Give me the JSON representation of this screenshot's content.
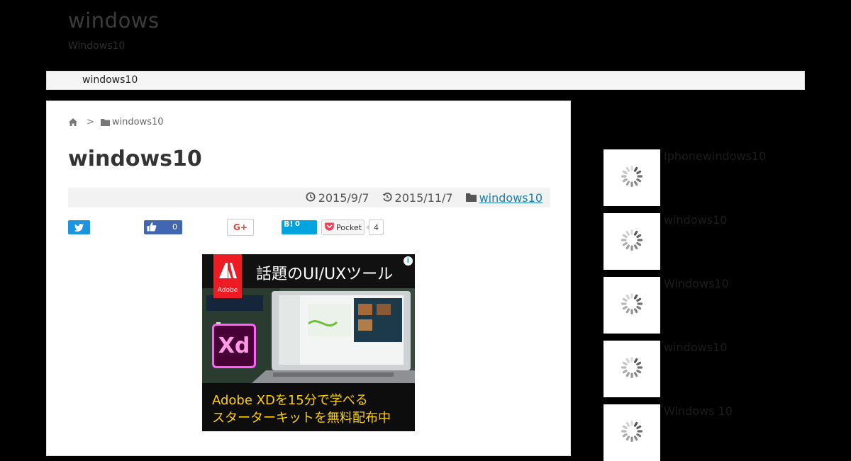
{
  "site": {
    "title": "windows",
    "description": "Windows10"
  },
  "nav": {
    "items": [
      {
        "label": "windows10"
      }
    ]
  },
  "breadcrumb": {
    "separator": ">",
    "category": "windows10"
  },
  "post": {
    "title": "windows10",
    "published": "2015/9/7",
    "updated": "2015/11/7",
    "category": "windows10"
  },
  "share": {
    "facebook_count": "0",
    "google_plus_label": "G+",
    "hatena_label": "B!",
    "hatena_count": "0",
    "pocket_label": "Pocket",
    "pocket_count": "4"
  },
  "ad": {
    "headline": "話題のUI/UXツール",
    "brand": "Adobe",
    "product_tile": "Xd",
    "line1": "Adobe XDを15分で学べる",
    "line2": "スターターキットを無料配布中",
    "choices_icon": "i"
  },
  "sidebar": {
    "items": [
      {
        "title": "Iphonewindows10"
      },
      {
        "title": "windows10"
      },
      {
        "title": "Windows10"
      },
      {
        "title": "windows10"
      },
      {
        "title": "Windows 10"
      }
    ]
  },
  "icons": {
    "home": "home-icon",
    "folder": "folder-icon",
    "clock": "clock-icon",
    "history": "history-icon",
    "twitter": "twitter-icon",
    "thumbs_up": "thumbs-up-icon",
    "pocket": "pocket-icon",
    "spinner": "loading-spinner-icon"
  },
  "colors": {
    "page_background": "#000000",
    "link": "#1a7fa6",
    "twitter": "#1b95e0",
    "facebook": "#4267b2",
    "hatena": "#00a4de",
    "google_plus": "#dd4b39",
    "adobe_red": "#ed1c24",
    "ad_text_yellow": "#ffd200"
  }
}
